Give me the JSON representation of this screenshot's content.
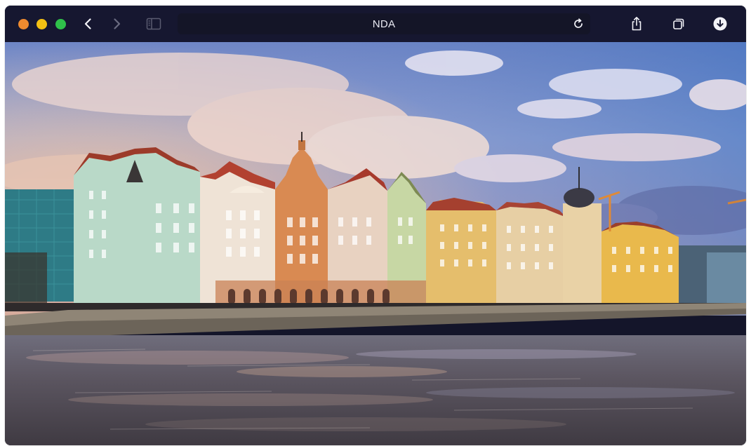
{
  "window": {
    "title": "NDA",
    "traffic_lights": {
      "close_color": "#ee8a2f",
      "minimize_color": "#f3c013",
      "zoom_color": "#2fc14a"
    }
  },
  "toolbar": {
    "back_icon": "chevron-left-icon",
    "forward_icon": "chevron-right-icon",
    "sidebar_icon": "sidebar-icon",
    "reload_icon": "reload-icon",
    "share_icon": "share-icon",
    "tabs_icon": "tabs-icon",
    "download_icon": "download-icon"
  },
  "content": {
    "image_subject": "riverside-embankment-photo"
  }
}
